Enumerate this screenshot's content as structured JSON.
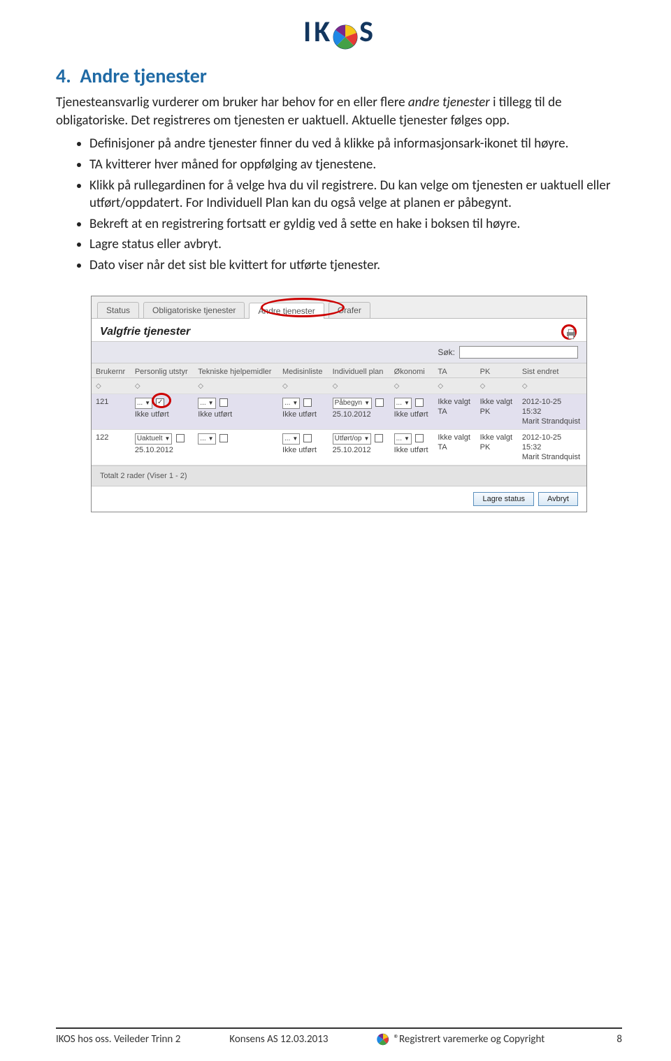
{
  "logo": {
    "name": "IKOS"
  },
  "heading": {
    "num": "4.",
    "title": "Andre tjenester"
  },
  "paragraph": {
    "p1a": "Tjenesteansvarlig vurderer om bruker har behov for en eller flere ",
    "p1b": "andre tjenester",
    "p1c": " i tillegg til de obligatoriske. Det registreres om tjenesten er uaktuell. Aktuelle tjenester følges opp."
  },
  "bullets": {
    "b1": "Definisjoner på andre tjenester finner du ved å klikke på informasjonsark-ikonet til høyre.",
    "b2": "TA kvitterer hver måned for oppfølging av tjenestene.",
    "b3a": "Klikk på rullegardinen for å velge hva du vil registrere. Du kan velge om tjenesten er ",
    "b3b": "uaktuell",
    "b3c": " eller ",
    "b3d": "utført/oppdatert",
    "b3e": ". For Individuell Plan kan du også velge at planen er ",
    "b3f": "påbegynt",
    "b3g": ".",
    "b4": "Bekreft at en registrering fortsatt er gyldig ved å sette en hake i boksen til høyre.",
    "b5": "Lagre status eller avbryt.",
    "b6": "Dato viser når det sist ble kvittert for utførte tjenester."
  },
  "shot": {
    "tabs": {
      "t1": "Status",
      "t2": "Obligatoriske tjenester",
      "t3": "Andre tjenester",
      "t4": "Grafer"
    },
    "panel_title": "Valgfrie tjenester",
    "search_label": "Søk:",
    "columns": {
      "c1": "Brukernr",
      "c2": "Personlig utstyr",
      "c3": "Tekniske hjelpemidler",
      "c4": "Medisinliste",
      "c5": "Individuell plan",
      "c6": "Økonomi",
      "c7": "TA",
      "c8": "PK",
      "c9": "Sist endret"
    },
    "row1": {
      "id": "121",
      "pu_dd": "...",
      "pu_status": "Ikke utført",
      "th_dd": "...",
      "th_status": "Ikke utført",
      "ml_dd": "...",
      "ml_status": "Ikke utført",
      "ip_dd": "Påbegyn",
      "ip_date": "25.10.2012",
      "ok_dd": "...",
      "ok_status": "Ikke utført",
      "ta1": "Ikke valgt",
      "ta2": "TA",
      "pk1": "Ikke valgt",
      "pk2": "PK",
      "se_date": "2012-10-25",
      "se_time": "15:32",
      "se_user": "Marit Strandquist"
    },
    "row2": {
      "id": "122",
      "pu_dd": "Uaktuelt",
      "pu_date": "25.10.2012",
      "th_dd": "...",
      "ml_dd": "...",
      "ml_status": "Ikke utført",
      "ip_dd": "Utført/op",
      "ip_date": "25.10.2012",
      "ok_dd": "...",
      "ok_status": "Ikke utført",
      "ta1": "Ikke valgt",
      "ta2": "TA",
      "pk1": "Ikke valgt",
      "pk2": "PK",
      "se_date": "2012-10-25",
      "se_time": "15:32",
      "se_user": "Marit Strandquist"
    },
    "total_row": "Totalt 2 rader (Viser 1 - 2)",
    "btn_save": "Lagre status",
    "btn_cancel": "Avbryt"
  },
  "footer": {
    "left": "IKOS hos oss. Veileder Trinn 2",
    "center": "Konsens AS 12.03.2013",
    "right": "®Registrert varemerke og Copyright",
    "pagenum": "8"
  }
}
